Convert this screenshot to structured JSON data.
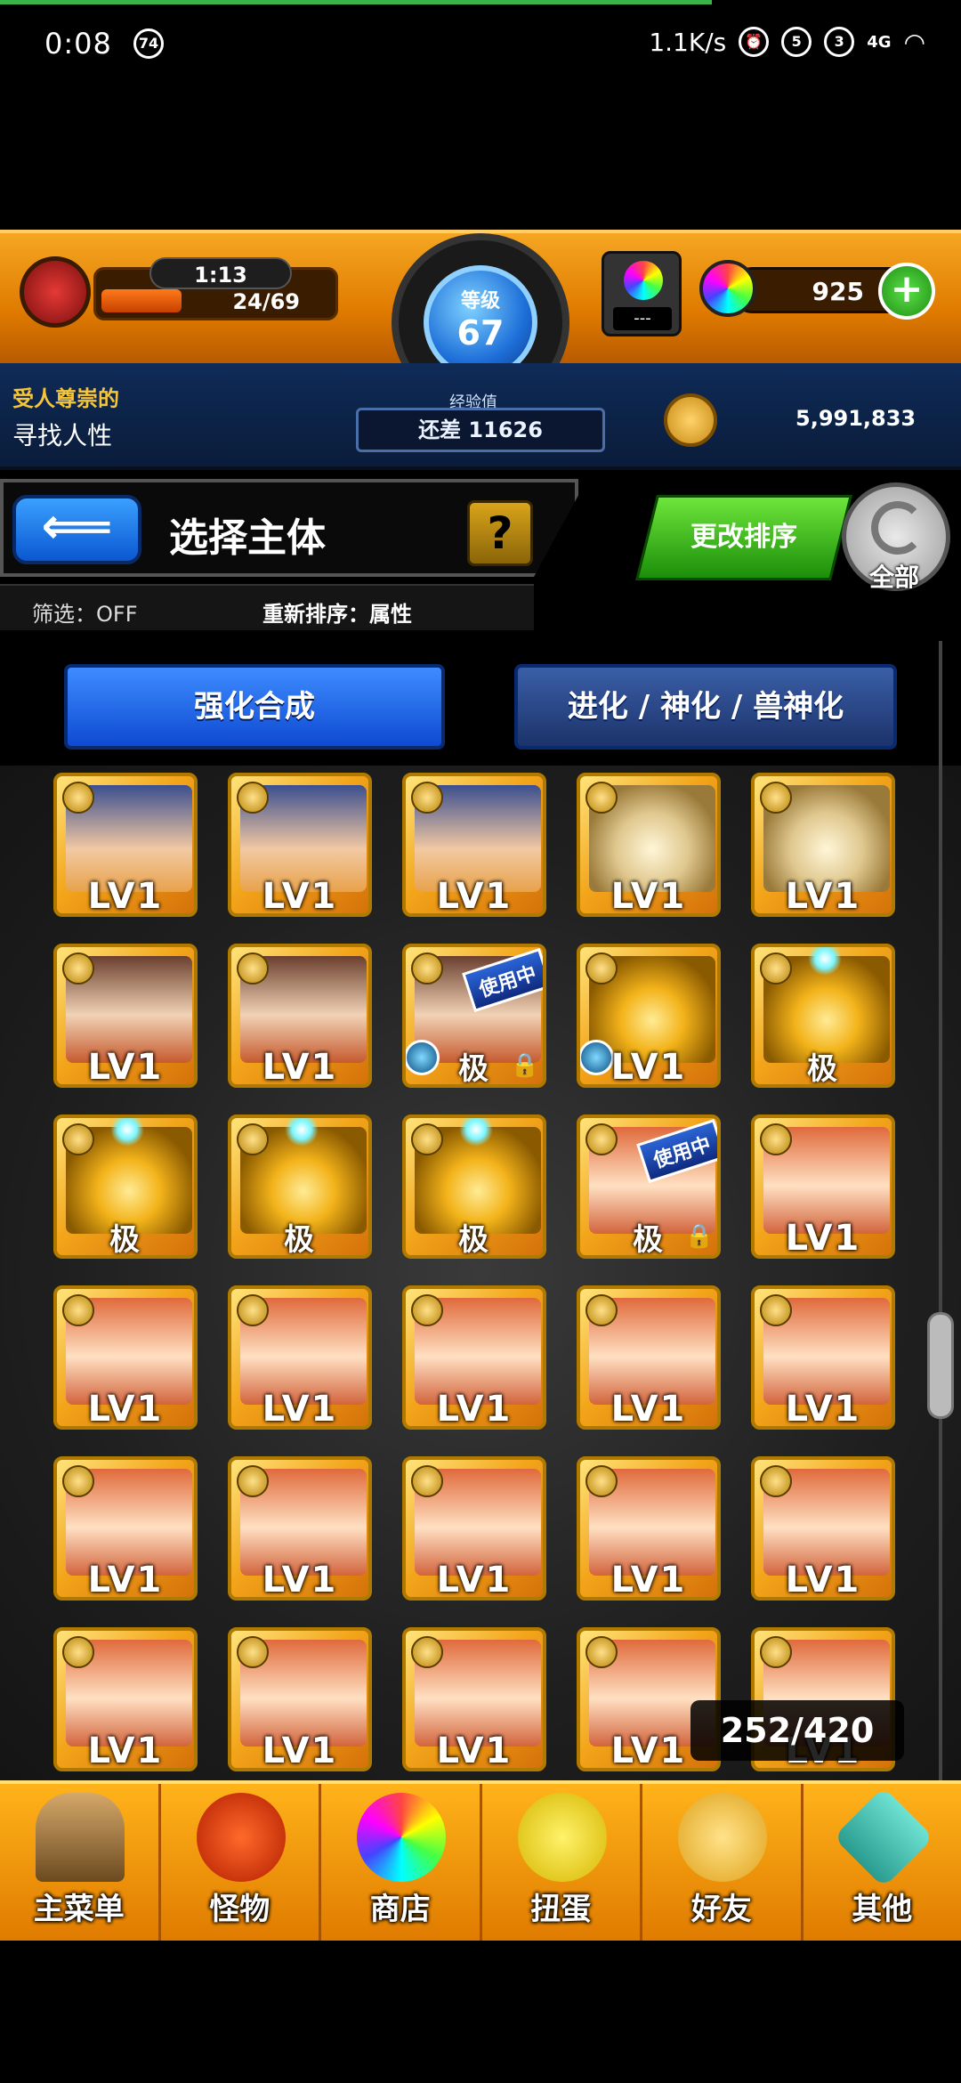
{
  "status_bar": {
    "time": "0:08",
    "badge": "74",
    "net_speed": "1.1K/s",
    "icons": [
      "alarm-icon",
      "sim-5g-icon",
      "sim-3g-icon",
      "4g-icon",
      "wifi-icon"
    ],
    "sim1": "5",
    "sim2": "3",
    "net": "4G"
  },
  "hud": {
    "stamina_timer": "1:13",
    "stamina": "24/69",
    "level_label": "等级",
    "level": "67",
    "gem_slot_text": "---",
    "stones": "925",
    "plus": "+",
    "title_gold": "受人尊崇的",
    "title_name": "寻找人性",
    "exp_label": "经验值",
    "exp_remaining": "还差 11626",
    "coins": "5,991,833"
  },
  "select": {
    "back": "⟸",
    "title": "选择主体",
    "help": "?",
    "filter": "筛选：OFF",
    "sort": "重新排序：属性",
    "change_sort": "更改排序",
    "all": "全部"
  },
  "actions": {
    "enhance": "强化合成",
    "evolve": "进化 / 神化 / 兽神化"
  },
  "monsters": [
    {
      "portrait": "p-a",
      "label": "LV1"
    },
    {
      "portrait": "p-a",
      "label": "LV1"
    },
    {
      "portrait": "p-a",
      "label": "LV1"
    },
    {
      "portrait": "p-b",
      "label": "LV1"
    },
    {
      "portrait": "p-b",
      "label": "LV1"
    },
    {
      "portrait": "p-c",
      "label": "LV1"
    },
    {
      "portrait": "p-c",
      "label": "LV1"
    },
    {
      "portrait": "p-c",
      "label": "极",
      "in_use": "使用中",
      "locked": true,
      "orb": true
    },
    {
      "portrait": "p-d",
      "label": "LV1",
      "orb": true
    },
    {
      "portrait": "p-d",
      "label": "极",
      "spark": true
    },
    {
      "portrait": "p-d",
      "label": "极",
      "spark": true
    },
    {
      "portrait": "p-d",
      "label": "极",
      "spark": true
    },
    {
      "portrait": "p-d",
      "label": "极",
      "spark": true
    },
    {
      "portrait": "p-e",
      "label": "极",
      "in_use": "使用中",
      "locked": true
    },
    {
      "portrait": "p-e",
      "label": "LV1"
    },
    {
      "portrait": "p-e",
      "label": "LV1"
    },
    {
      "portrait": "p-e",
      "label": "LV1"
    },
    {
      "portrait": "p-e",
      "label": "LV1"
    },
    {
      "portrait": "p-e",
      "label": "LV1"
    },
    {
      "portrait": "p-e",
      "label": "LV1"
    },
    {
      "portrait": "p-e",
      "label": "LV1"
    },
    {
      "portrait": "p-e",
      "label": "LV1"
    },
    {
      "portrait": "p-e",
      "label": "LV1"
    },
    {
      "portrait": "p-e",
      "label": "LV1"
    },
    {
      "portrait": "p-e",
      "label": "LV1"
    },
    {
      "portrait": "p-e",
      "label": "LV1"
    },
    {
      "portrait": "p-e",
      "label": "LV1"
    },
    {
      "portrait": "p-e",
      "label": "LV1"
    },
    {
      "portrait": "p-e",
      "label": "LV1"
    },
    {
      "portrait": "p-e",
      "label": "LV1"
    }
  ],
  "box_count": "252/420",
  "nav": [
    {
      "label": "主菜单",
      "icon": "ico-home",
      "name": "nav-main-menu"
    },
    {
      "label": "怪物",
      "icon": "ico-monster",
      "name": "nav-monsters"
    },
    {
      "label": "商店",
      "icon": "ico-shop",
      "name": "nav-shop"
    },
    {
      "label": "扭蛋",
      "icon": "ico-gacha",
      "name": "nav-gacha"
    },
    {
      "label": "好友",
      "icon": "ico-friend",
      "name": "nav-friends"
    },
    {
      "label": "其他",
      "icon": "ico-other",
      "name": "nav-other"
    }
  ]
}
